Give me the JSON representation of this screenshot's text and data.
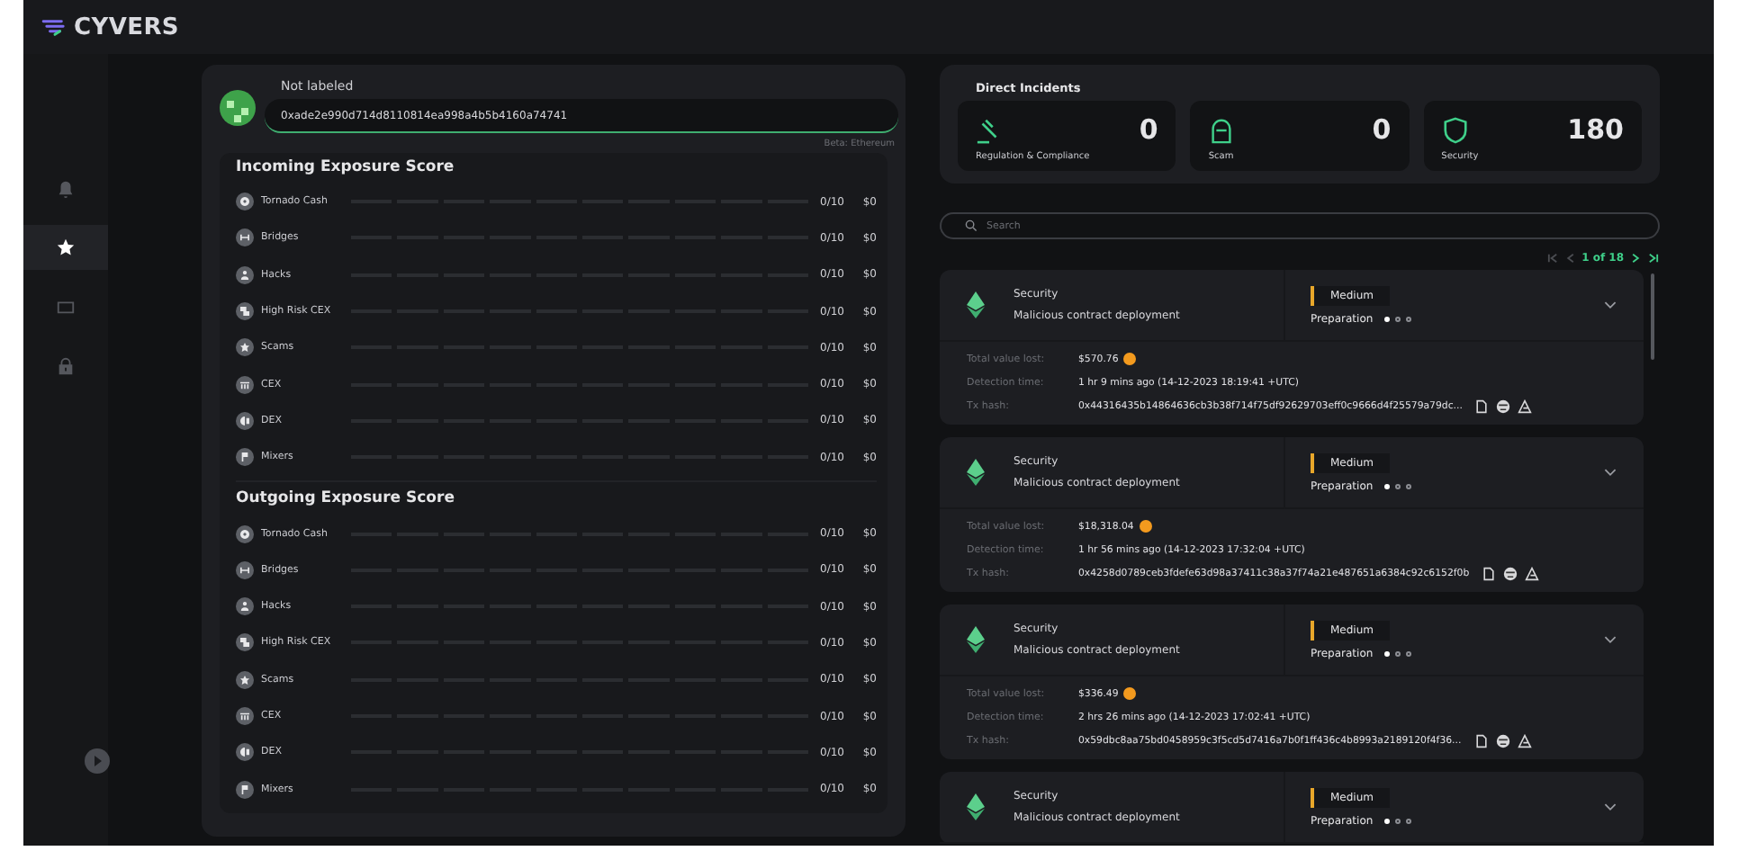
{
  "app": {
    "logo": "CYVERS"
  },
  "sidebar": {
    "items": [
      {
        "kind": "bell",
        "selected": false
      },
      {
        "kind": "star",
        "selected": true
      },
      {
        "kind": "message",
        "selected": false
      },
      {
        "kind": "lock",
        "selected": false
      }
    ]
  },
  "wallet": {
    "label": "Not labeled",
    "address": "0xade2e990d714d8110814ea998a4b5b4160a74741",
    "network": "Beta: Ethereum"
  },
  "exposure": [
    {
      "title": "Incoming Exposure Score",
      "rows": [
        {
          "kind": "tornado",
          "label": "Tornado Cash",
          "score": "0/10",
          "amount": "$0"
        },
        {
          "kind": "bridge",
          "label": "Bridges",
          "score": "0/10",
          "amount": "$0"
        },
        {
          "kind": "hack",
          "label": "Hacks",
          "score": "0/10",
          "amount": "$0"
        },
        {
          "kind": "risk",
          "label": "High Risk CEX",
          "score": "0/10",
          "amount": "$0"
        },
        {
          "kind": "scam",
          "label": "Scams",
          "score": "0/10",
          "amount": "$0"
        },
        {
          "kind": "cex",
          "label": "CEX",
          "score": "0/10",
          "amount": "$0"
        },
        {
          "kind": "dex",
          "label": "DEX",
          "score": "0/10",
          "amount": "$0"
        },
        {
          "kind": "mixer",
          "label": "Mixers",
          "score": "0/10",
          "amount": "$0"
        }
      ]
    },
    {
      "title": "Outgoing Exposure Score",
      "rows": [
        {
          "kind": "tornado",
          "label": "Tornado Cash",
          "score": "0/10",
          "amount": "$0"
        },
        {
          "kind": "bridge",
          "label": "Bridges",
          "score": "0/10",
          "amount": "$0"
        },
        {
          "kind": "hack",
          "label": "Hacks",
          "score": "0/10",
          "amount": "$0"
        },
        {
          "kind": "risk",
          "label": "High Risk CEX",
          "score": "0/10",
          "amount": "$0"
        },
        {
          "kind": "scam",
          "label": "Scams",
          "score": "0/10",
          "amount": "$0"
        },
        {
          "kind": "cex",
          "label": "CEX",
          "score": "0/10",
          "amount": "$0"
        },
        {
          "kind": "dex",
          "label": "DEX",
          "score": "0/10",
          "amount": "$0"
        },
        {
          "kind": "mixer",
          "label": "Mixers",
          "score": "0/10",
          "amount": "$0"
        }
      ]
    }
  ],
  "incidents": {
    "title": "Direct Incidents",
    "tiles": [
      {
        "kind": "gavel",
        "label": "Regulation & Compliance",
        "count": "0"
      },
      {
        "kind": "thief",
        "label": "Scam",
        "count": "0"
      },
      {
        "kind": "shield",
        "label": "Security",
        "count": "180"
      }
    ]
  },
  "search": {
    "placeholder": "Search"
  },
  "pagination": {
    "text": "1 of 18"
  },
  "alerts": [
    {
      "category": "Security",
      "title": "Malicious contract deployment",
      "severity": "Medium",
      "phase": "Preparation",
      "steps": [
        {
          "done": true
        },
        {
          "done": false
        },
        {
          "done": false
        }
      ],
      "details": [
        {
          "kind": "value",
          "label": "Total value lost:",
          "value": "$570.76"
        },
        {
          "kind": "time",
          "label": "Detection time:",
          "value": "1 hr 9 mins ago (14-12-2023 18:19:41 +UTC)"
        },
        {
          "kind": "hash",
          "label": "Tx hash:",
          "value": "0x44316435b14864636cb3b38f714f75df92629703eff0c9666d4f25579a79dc..."
        }
      ]
    },
    {
      "category": "Security",
      "title": "Malicious contract deployment",
      "severity": "Medium",
      "phase": "Preparation",
      "steps": [
        {
          "done": true
        },
        {
          "done": false
        },
        {
          "done": false
        }
      ],
      "details": [
        {
          "kind": "value",
          "label": "Total value lost:",
          "value": "$18,318.04"
        },
        {
          "kind": "time",
          "label": "Detection time:",
          "value": "1 hr 56 mins ago (14-12-2023 17:32:04 +UTC)"
        },
        {
          "kind": "hash",
          "label": "Tx hash:",
          "value": "0x4258d0789ceb3fdefe63d98a37411c38a37f74a21e487651a6384c92c6152f0b"
        }
      ]
    },
    {
      "category": "Security",
      "title": "Malicious contract deployment",
      "severity": "Medium",
      "phase": "Preparation",
      "steps": [
        {
          "done": true
        },
        {
          "done": false
        },
        {
          "done": false
        }
      ],
      "details": [
        {
          "kind": "value",
          "label": "Total value lost:",
          "value": "$336.49"
        },
        {
          "kind": "time",
          "label": "Detection time:",
          "value": "2 hrs 26 mins ago (14-12-2023 17:02:41 +UTC)"
        },
        {
          "kind": "hash",
          "label": "Tx hash:",
          "value": "0x59dbc8aa75bd0458959c3f5cd5d7416a7b0f1ff436c4b8993a2189120f4f36..."
        }
      ]
    },
    {
      "category": "Security",
      "title": "Malicious contract deployment",
      "severity": "Medium",
      "phase": "Preparation",
      "steps": [
        {
          "done": true
        },
        {
          "done": false
        },
        {
          "done": false
        }
      ]
    }
  ]
}
